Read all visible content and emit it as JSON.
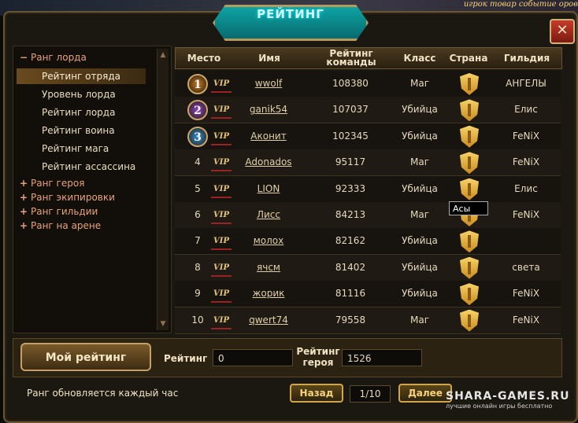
{
  "top_links": "игрок   товар   событие   оров",
  "title": "РЕЙТИНГ",
  "close_glyph": "✕",
  "sidebar": {
    "groups": [
      {
        "sign": "−",
        "label": "Ранг лорда"
      },
      {
        "sign": "+",
        "label": "Ранг героя"
      },
      {
        "sign": "+",
        "label": "Ранг экипировки"
      },
      {
        "sign": "+",
        "label": "Ранг гильдии"
      },
      {
        "sign": "+",
        "label": "Ранг на арене"
      }
    ],
    "lord_items": [
      "Рейтинг отряда",
      "Уровень лорда",
      "Рейтинг лорда",
      "Рейтинг воина",
      "Рейтинг мага",
      "Рейтинг ассассина"
    ]
  },
  "table": {
    "headers": {
      "place": "Место",
      "name": "Имя",
      "rating": "Рейтинг команды",
      "class": "Класс",
      "country": "Страна",
      "guild": "Гильдия"
    },
    "vip_label": "VIP",
    "rows": [
      {
        "place": "1",
        "name": "wwolf",
        "rating": "108380",
        "cls": "Маг",
        "guild": "АНГЕЛЫ"
      },
      {
        "place": "2",
        "name": "ganik54",
        "rating": "107037",
        "cls": "Убийца",
        "guild": "Елис"
      },
      {
        "place": "3",
        "name": "Аконит",
        "rating": "102345",
        "cls": "Убийца",
        "guild": "FeNiX"
      },
      {
        "place": "4",
        "name": "Adonados",
        "rating": "95117",
        "cls": "Маг",
        "guild": "FeNiX"
      },
      {
        "place": "5",
        "name": "LION",
        "rating": "92333",
        "cls": "Убийца",
        "guild": "Елис"
      },
      {
        "place": "6",
        "name": "Лисс",
        "rating": "84213",
        "cls": "Маг",
        "guild": "FeNiX"
      },
      {
        "place": "7",
        "name": "молох",
        "rating": "82162",
        "cls": "Убийца",
        "guild": ""
      },
      {
        "place": "8",
        "name": "ячсм",
        "rating": "81402",
        "cls": "Убийца",
        "guild": "света"
      },
      {
        "place": "9",
        "name": "жорик",
        "rating": "81116",
        "cls": "Убийца",
        "guild": "FeNiX"
      },
      {
        "place": "10",
        "name": "qwert74",
        "rating": "79558",
        "cls": "Маг",
        "guild": "FeNiX"
      }
    ]
  },
  "tooltip": "Асы",
  "bottom": {
    "my_rating_label": "Мой рейтинг",
    "rating_label": "Рейтинг",
    "rating_value": "0",
    "hero_rating_label_1": "Рейтинг",
    "hero_rating_label_2": "героя",
    "hero_rating_value": "1526",
    "footer_note": "Ранг обновляется каждый час",
    "back_label": "Назад",
    "page_label": "1/10",
    "next_label": "Далее"
  },
  "watermark": {
    "brand": "SHARA-GAMES.RU",
    "tagline": "лучшие онлайн    игры бесплатно"
  },
  "colors": {
    "teal_title": "#0fa3a3",
    "gold": "#d1a54a",
    "accent_category": "#e6a27a"
  }
}
